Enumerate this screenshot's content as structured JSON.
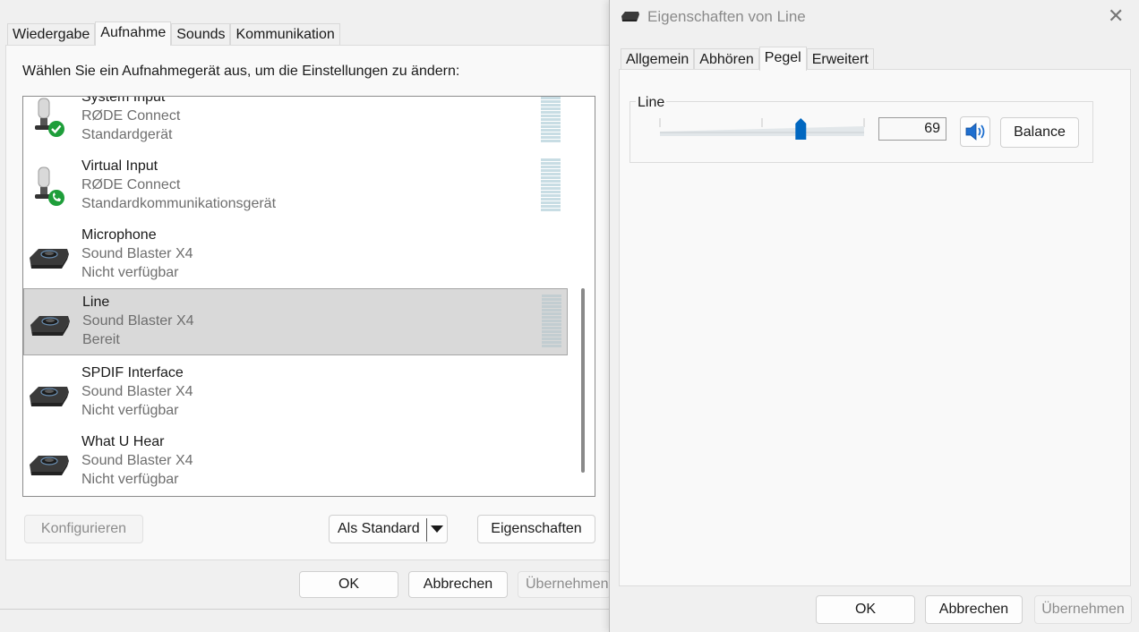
{
  "sound_dialog": {
    "tabs": [
      "Wiedergabe",
      "Aufnahme",
      "Sounds",
      "Kommunikation"
    ],
    "active_tab": "Aufnahme",
    "instruction": "Wählen Sie ein Aufnahmegerät aus, um die Einstellungen zu ändern:",
    "devices": [
      {
        "name": "System Input",
        "sub": "RØDE Connect",
        "status": "Standardgerät",
        "icon": "microphone-default-icon"
      },
      {
        "name": "Virtual Input",
        "sub": "RØDE Connect",
        "status": "Standardkommunikationsgerät",
        "icon": "microphone-communication-icon"
      },
      {
        "name": "Microphone",
        "sub": "Sound Blaster X4",
        "status": "Nicht verfügbar",
        "icon": "sound-blaster-icon"
      },
      {
        "name": "Line",
        "sub": "Sound Blaster X4",
        "status": "Bereit",
        "icon": "sound-blaster-icon"
      },
      {
        "name": "SPDIF Interface",
        "sub": "Sound Blaster X4",
        "status": "Nicht verfügbar",
        "icon": "sound-blaster-icon"
      },
      {
        "name": "What U Hear",
        "sub": "Sound Blaster X4",
        "status": "Nicht verfügbar",
        "icon": "sound-blaster-icon"
      }
    ],
    "selected_device": "Line",
    "buttons": {
      "configure": "Konfigurieren",
      "set_default": "Als Standard",
      "properties": "Eigenschaften",
      "ok": "OK",
      "cancel": "Abbrechen",
      "apply": "Übernehmen"
    }
  },
  "props_dialog": {
    "title": "Eigenschaften von Line",
    "tabs": [
      "Allgemein",
      "Abhören",
      "Pegel",
      "Erweitert"
    ],
    "active_tab": "Pegel",
    "level": {
      "label": "Line",
      "value": "69",
      "fraction": 0.69,
      "balance_label": "Balance"
    },
    "buttons": {
      "ok": "OK",
      "cancel": "Abbrechen",
      "apply": "Übernehmen"
    }
  },
  "colors": {
    "accent": "#0067c0",
    "success_green": "#1e9e3a"
  }
}
